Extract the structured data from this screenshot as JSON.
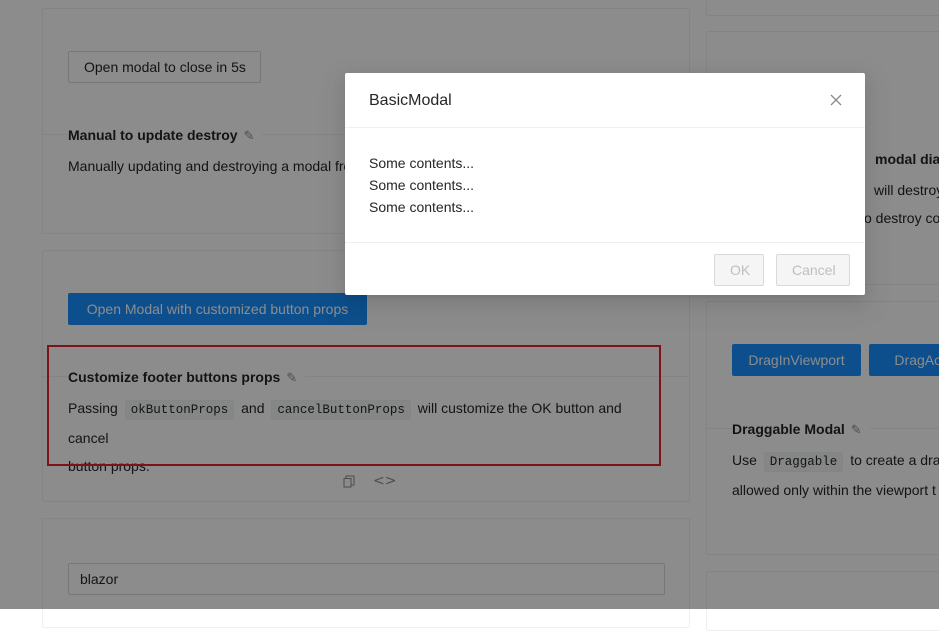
{
  "left_column": {
    "card1": {
      "button_label": "Open modal to close in 5s",
      "title": "Manual to update destroy",
      "description": "Manually updating and destroying a modal from Modal.method."
    },
    "card2": {
      "button_label": "Open Modal with customized button props",
      "title": "Customize footer buttons props",
      "desc_before": "Passing",
      "code1": "okButtonProps",
      "desc_and": "and",
      "code2": "cancelButtonProps",
      "desc_after": "will customize the OK button and cancel",
      "desc_line2": "button props."
    },
    "card3": {
      "input_value": "blazor"
    }
  },
  "right_column": {
    "card1": {
      "title_fragment": "modal dialo",
      "line1_fragment": "will destroy",
      "line2_fragment": "o destroy co"
    },
    "card2": {
      "button1_label": "DragInViewport",
      "button2_label": "DragAcro",
      "title": "Draggable Modal",
      "desc_before": "Use",
      "code": "Draggable",
      "desc_after": "to create a dragg",
      "desc_line2": "allowed only within the viewport t"
    }
  },
  "modal": {
    "title": "BasicModal",
    "close_icon": "close-icon",
    "body_lines": [
      "Some contents...",
      "Some contents...",
      "Some contents..."
    ],
    "ok_label": "OK",
    "cancel_label": "Cancel"
  },
  "colors": {
    "primary": "#1890ff",
    "highlight_border": "#e0242c",
    "mask": "rgba(0,0,0,0.45)"
  }
}
